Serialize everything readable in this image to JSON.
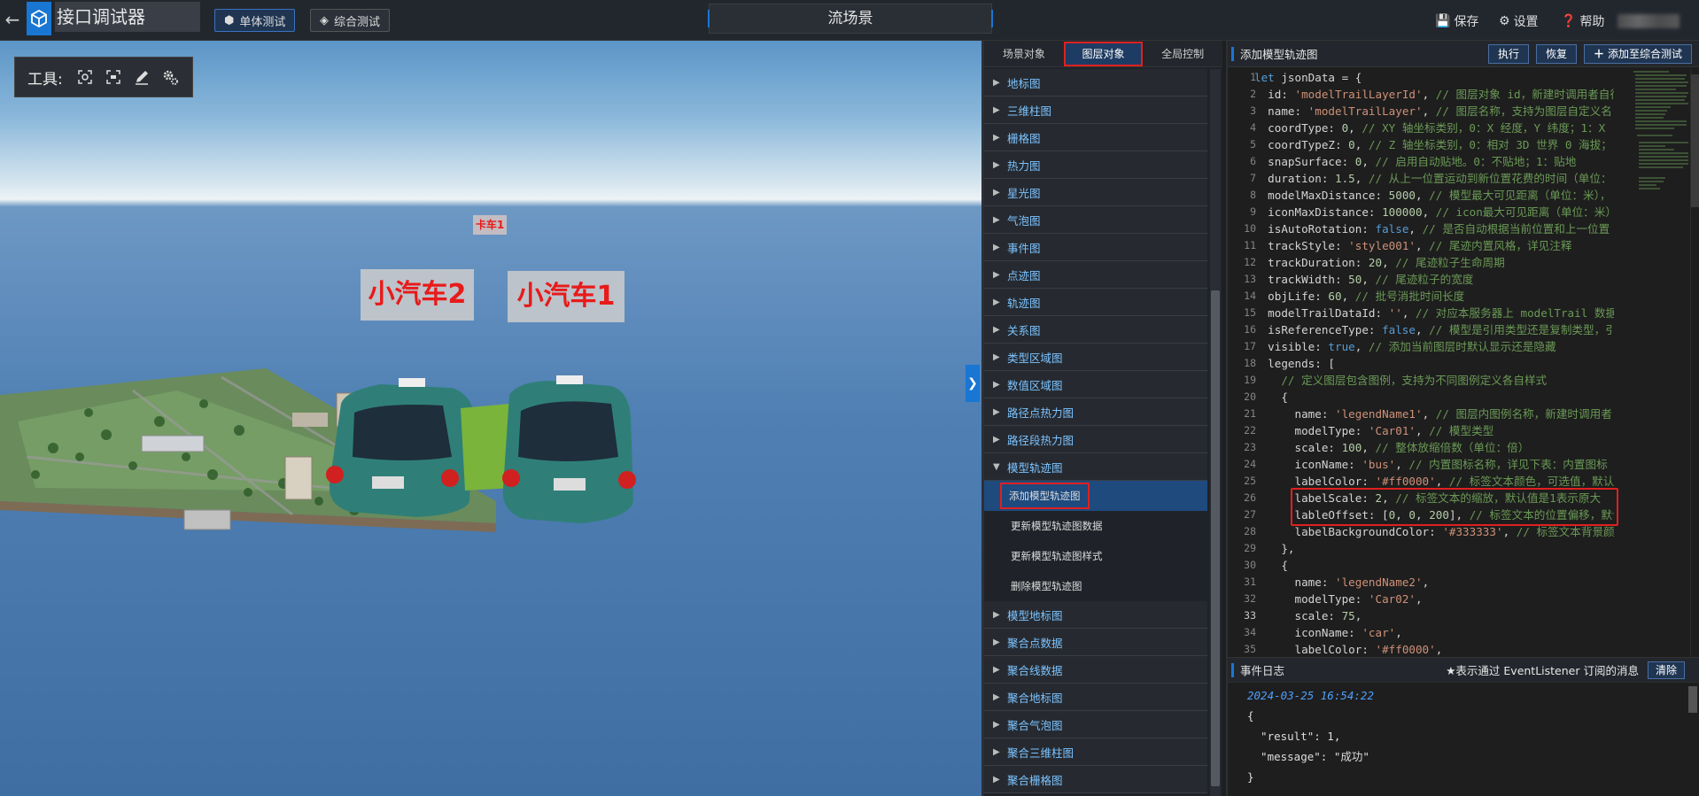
{
  "topbar": {
    "app_title": "接口调试器",
    "mode_single": "单体测试",
    "mode_combined": "综合测试",
    "scene_title": "流场景",
    "save": "保存",
    "settings": "设置",
    "help": "帮助"
  },
  "viewport": {
    "tools_label": "工具:",
    "tag_small": "卡车1",
    "tag_car2": "小汽车2",
    "tag_car1": "小汽车1"
  },
  "menu": {
    "tabs": [
      "场景对象",
      "图层对象",
      "全局控制"
    ],
    "active_tab": "图层对象",
    "items_before": [
      "地标图",
      "三维柱图",
      "栅格图",
      "热力图",
      "星光图",
      "气泡图",
      "事件图",
      "点迹图",
      "轨迹图",
      "关系图",
      "类型区域图",
      "数值区域图",
      "路径点热力图",
      "路径段热力图"
    ],
    "expanded": "模型轨迹图",
    "sub_items": [
      "添加模型轨迹图",
      "更新模型轨迹图数据",
      "更新模型轨迹图样式",
      "删除模型轨迹图"
    ],
    "active_sub": "添加模型轨迹图",
    "items_after": [
      "模型地标图",
      "聚合点数据",
      "聚合线数据",
      "聚合地标图",
      "聚合气泡图",
      "聚合三维柱图",
      "聚合栅格图"
    ]
  },
  "code_panel": {
    "title": "添加模型轨迹图",
    "execute": "执行",
    "restore": "恢复",
    "add_to_combined": "添加至综合测试",
    "line_numbers": [
      "1",
      "2",
      "3",
      "4",
      "5",
      "6",
      "7",
      "8",
      "9",
      "10",
      "11",
      "12",
      "13",
      "14",
      "15",
      "16",
      "17",
      "18",
      "19",
      "20",
      "21",
      "22",
      "23",
      "24",
      "25",
      "26",
      "27",
      "28",
      "29",
      "30",
      "31",
      "32",
      "33",
      "34",
      "35"
    ],
    "lines": [
      [
        [
          "kw",
          "let "
        ],
        [
          "prop",
          "jsonData = {"
        ]
      ],
      [
        [
          "prop",
          "  id: "
        ],
        [
          "str",
          "'modelTrailLayerId'"
        ],
        [
          "prop",
          ", "
        ],
        [
          "cm",
          "// 图层对象 id，新建时调用者自行"
        ]
      ],
      [
        [
          "prop",
          "  name: "
        ],
        [
          "str",
          "'modelTrailLayer'"
        ],
        [
          "prop",
          ", "
        ],
        [
          "cm",
          "// 图层名称，支持为图层自定义名"
        ]
      ],
      [
        [
          "prop",
          "  coordType: "
        ],
        [
          "num",
          "0"
        ],
        [
          "prop",
          ", "
        ],
        [
          "cm",
          "// XY 轴坐标类别，0：X 经度，Y 纬度；1：X"
        ]
      ],
      [
        [
          "prop",
          "  coordTypeZ: "
        ],
        [
          "num",
          "0"
        ],
        [
          "prop",
          ", "
        ],
        [
          "cm",
          "// Z 轴坐标类别，0：相对 3D 世界 0 海拔；"
        ]
      ],
      [
        [
          "prop",
          "  snapSurface: "
        ],
        [
          "num",
          "0"
        ],
        [
          "prop",
          ", "
        ],
        [
          "cm",
          "// 启用自动贴地。0：不贴地；1：贴地"
        ]
      ],
      [
        [
          "prop",
          "  duration: "
        ],
        [
          "num",
          "1.5"
        ],
        [
          "prop",
          ", "
        ],
        [
          "cm",
          "// 从上一位置运动到新位置花费的时间（单位："
        ]
      ],
      [
        [
          "prop",
          "  modelMaxDistance: "
        ],
        [
          "num",
          "5000"
        ],
        [
          "prop",
          ", "
        ],
        [
          "cm",
          "// 模型最大可见距离（单位：米），"
        ]
      ],
      [
        [
          "prop",
          "  iconMaxDistance: "
        ],
        [
          "num",
          "100000"
        ],
        [
          "prop",
          ", "
        ],
        [
          "cm",
          "// icon最大可见距离（单位：米）"
        ]
      ],
      [
        [
          "prop",
          "  isAutoRotation: "
        ],
        [
          "bool",
          "false"
        ],
        [
          "prop",
          ", "
        ],
        [
          "cm",
          "// 是否自动根据当前位置和上一位置"
        ]
      ],
      [
        [
          "prop",
          "  trackStyle: "
        ],
        [
          "str",
          "'style001'"
        ],
        [
          "prop",
          ", "
        ],
        [
          "cm",
          "// 尾迹内置风格，详见注释"
        ]
      ],
      [
        [
          "prop",
          "  trackDuration: "
        ],
        [
          "num",
          "20"
        ],
        [
          "prop",
          ", "
        ],
        [
          "cm",
          "// 尾迹粒子生命周期"
        ]
      ],
      [
        [
          "prop",
          "  trackWidth: "
        ],
        [
          "num",
          "50"
        ],
        [
          "prop",
          ", "
        ],
        [
          "cm",
          "// 尾迹粒子的宽度"
        ]
      ],
      [
        [
          "prop",
          "  objLife: "
        ],
        [
          "num",
          "60"
        ],
        [
          "prop",
          ", "
        ],
        [
          "cm",
          "// 批号消批时间长度"
        ]
      ],
      [
        [
          "prop",
          "  modelTrailDataId: "
        ],
        [
          "str",
          "''"
        ],
        [
          "prop",
          ", "
        ],
        [
          "cm",
          "// 对应本服务器上 modelTrail 数据"
        ]
      ],
      [
        [
          "prop",
          "  isReferenceType: "
        ],
        [
          "bool",
          "false"
        ],
        [
          "prop",
          ", "
        ],
        [
          "cm",
          "// 模型是引用类型还是复制类型，引"
        ]
      ],
      [
        [
          "prop",
          "  visible: "
        ],
        [
          "bool",
          "true"
        ],
        [
          "prop",
          ", "
        ],
        [
          "cm",
          "// 添加当前图层时默认显示还是隐藏"
        ]
      ],
      [
        [
          "prop",
          "  legends: ["
        ]
      ],
      [
        [
          "cm",
          "    // 定义图层包含图例，支持为不同图例定义各自样式"
        ]
      ],
      [
        [
          "prop",
          "    {"
        ]
      ],
      [
        [
          "prop",
          "      name: "
        ],
        [
          "str",
          "'legendName1'"
        ],
        [
          "prop",
          ", "
        ],
        [
          "cm",
          "// 图层内图例名称，新建时调用者"
        ]
      ],
      [
        [
          "prop",
          "      modelType: "
        ],
        [
          "str",
          "'Car01'"
        ],
        [
          "prop",
          ", "
        ],
        [
          "cm",
          "// 模型类型"
        ]
      ],
      [
        [
          "prop",
          "      scale: "
        ],
        [
          "num",
          "100"
        ],
        [
          "prop",
          ", "
        ],
        [
          "cm",
          "// 整体放缩倍数（单位：倍）"
        ]
      ],
      [
        [
          "prop",
          "      iconName: "
        ],
        [
          "str",
          "'bus'"
        ],
        [
          "prop",
          ", "
        ],
        [
          "cm",
          "// 内置图标名称，详见下表：内置图标"
        ]
      ],
      [
        [
          "prop",
          "      labelColor: "
        ],
        [
          "str",
          "'#ff0000'"
        ],
        [
          "prop",
          ", "
        ],
        [
          "cm",
          "// 标签文本颜色，可选值，默认"
        ]
      ],
      [
        [
          "prop",
          "      labelScale: "
        ],
        [
          "num",
          "2"
        ],
        [
          "prop",
          ", "
        ],
        [
          "cm",
          "// 标签文本的缩放，默认值是1表示原大"
        ]
      ],
      [
        [
          "prop",
          "      lableOffset: ["
        ],
        [
          "num",
          "0"
        ],
        [
          "prop",
          ", "
        ],
        [
          "num",
          "0"
        ],
        [
          "prop",
          ", "
        ],
        [
          "num",
          "200"
        ],
        [
          "prop",
          "], "
        ],
        [
          "cm",
          "// 标签文本的位置偏移，默认"
        ]
      ],
      [
        [
          "prop",
          "      labelBackgroundColor: "
        ],
        [
          "str",
          "'#333333'"
        ],
        [
          "prop",
          ", "
        ],
        [
          "cm",
          "// 标签文本背景颜色"
        ]
      ],
      [
        [
          "prop",
          "    },"
        ]
      ],
      [
        [
          "prop",
          "    {"
        ]
      ],
      [
        [
          "prop",
          "      name: "
        ],
        [
          "str",
          "'legendName2'"
        ],
        [
          "prop",
          ","
        ]
      ],
      [
        [
          "prop",
          "      modelType: "
        ],
        [
          "str",
          "'Car02'"
        ],
        [
          "prop",
          ","
        ]
      ],
      [
        [
          "prop",
          "      scale: "
        ],
        [
          "num",
          "75"
        ],
        [
          "prop",
          ","
        ]
      ],
      [
        [
          "prop",
          "      iconName: "
        ],
        [
          "str",
          "'car'"
        ],
        [
          "prop",
          ","
        ]
      ],
      [
        [
          "prop",
          "      labelColor: "
        ],
        [
          "str",
          "'#ff0000'"
        ],
        [
          "prop",
          ","
        ]
      ]
    ]
  },
  "event_log": {
    "title": "事件日志",
    "note": "★表示通过 EventListener 订阅的消息",
    "clear": "清除",
    "timestamp": "2024-03-25 16:54:22",
    "lines": [
      "{",
      "  \"result\": 1,",
      "  \"message\": \"成功\"",
      "}"
    ]
  },
  "colors": {
    "accent": "#1976d2",
    "highlight": "#e02020",
    "link": "#7cc3ff"
  }
}
